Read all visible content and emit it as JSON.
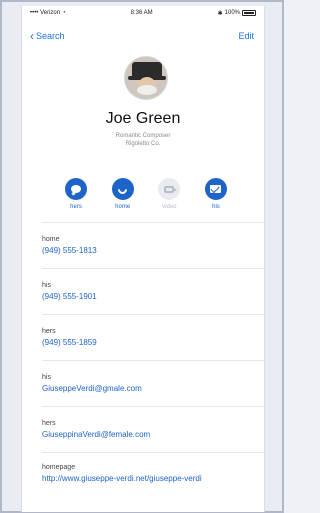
{
  "status_bar": {
    "carrier": "•••• Verizon",
    "time": "8:36 AM",
    "battery": "100%"
  },
  "nav": {
    "back_label": "Search",
    "edit_label": "Edit"
  },
  "contact": {
    "name": "Joe Green",
    "subtitle_line1": "Romantic Composer",
    "subtitle_line2": "Rigoletto Co."
  },
  "actions": [
    {
      "label": "hers",
      "icon": "message-icon",
      "enabled": true
    },
    {
      "label": "home",
      "icon": "phone-icon",
      "enabled": true
    },
    {
      "label": "video",
      "icon": "video-icon",
      "enabled": false
    },
    {
      "label": "his",
      "icon": "mail-icon",
      "enabled": true
    }
  ],
  "fields": [
    {
      "label": "home",
      "value": "(949) 555-1813"
    },
    {
      "label": "his",
      "value": "(949) 555-1901"
    },
    {
      "label": "hers",
      "value": "(949) 555-1859"
    },
    {
      "label": "his",
      "value": "GiuseppeVerdi@gmale.com"
    },
    {
      "label": "hers",
      "value": "GiuseppinaVerdi@female.com"
    },
    {
      "label": "homepage",
      "value": "http://www.giuseppe-verdi.net/giuseppe-verdi"
    }
  ],
  "colors": {
    "accent": "#1e63c8",
    "disabled": "#b7bcc5"
  }
}
